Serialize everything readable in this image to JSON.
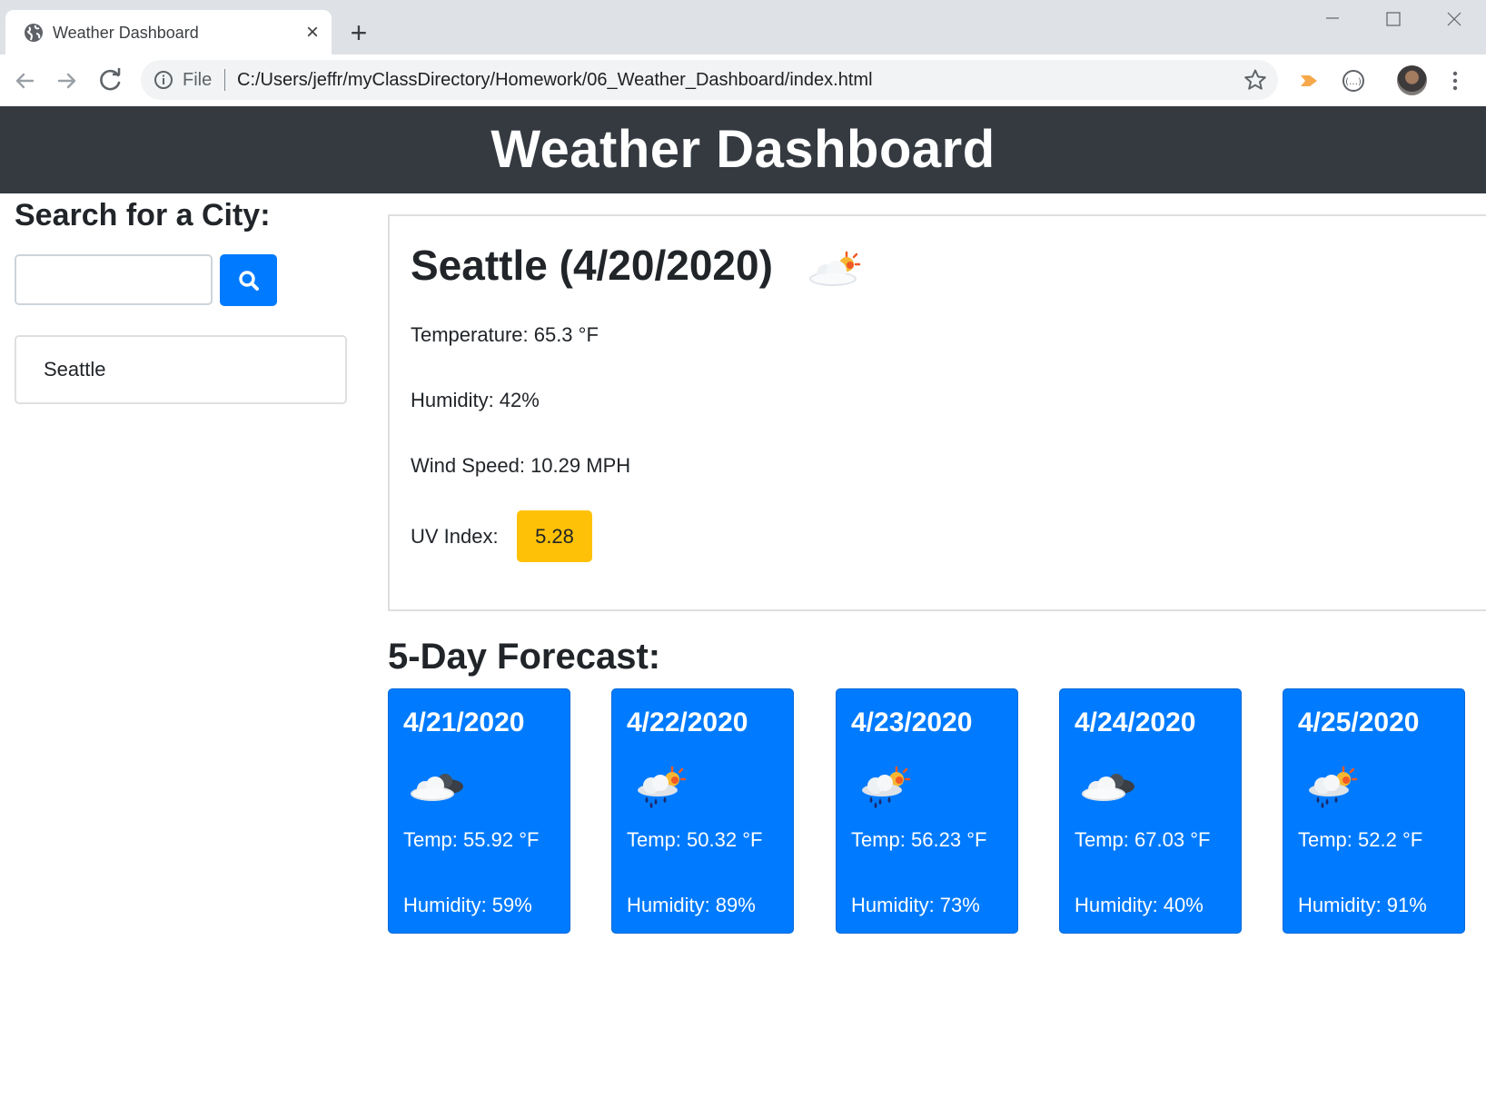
{
  "browser": {
    "tab_title": "Weather Dashboard",
    "address_prefix": "File",
    "url": "C:/Users/jeffr/myClassDirectory/Homework/06_Weather_Dashboard/index.html"
  },
  "header": {
    "title": "Weather Dashboard"
  },
  "sidebar": {
    "heading": "Search for a City:",
    "search": {
      "value": "",
      "placeholder": ""
    },
    "history": [
      "Seattle"
    ]
  },
  "current": {
    "title": "Seattle (4/20/2020)",
    "icon": "cloud-sun-icon",
    "temperature": "Temperature: 65.3 °F",
    "humidity": "Humidity: 42%",
    "wind": "Wind Speed: 10.29 MPH",
    "uv_label": "UV Index:",
    "uv_value": "5.28",
    "uv_color": "#ffc107"
  },
  "forecast": {
    "heading": "5-Day Forecast:",
    "card_color": "#007bff",
    "days": [
      {
        "date": "4/21/2020",
        "icon": "cloud-dark-icon",
        "temp": "Temp: 55.92 °F",
        "humidity": "Humidity: 59%"
      },
      {
        "date": "4/22/2020",
        "icon": "rain-sun-icon",
        "temp": "Temp: 50.32 °F",
        "humidity": "Humidity: 89%"
      },
      {
        "date": "4/23/2020",
        "icon": "rain-sun-icon",
        "temp": "Temp: 56.23 °F",
        "humidity": "Humidity: 73%"
      },
      {
        "date": "4/24/2020",
        "icon": "cloud-dark-icon",
        "temp": "Temp: 67.03 °F",
        "humidity": "Humidity: 40%"
      },
      {
        "date": "4/25/2020",
        "icon": "rain-sun-icon",
        "temp": "Temp: 52.2 °F",
        "humidity": "Humidity: 91%"
      }
    ]
  }
}
